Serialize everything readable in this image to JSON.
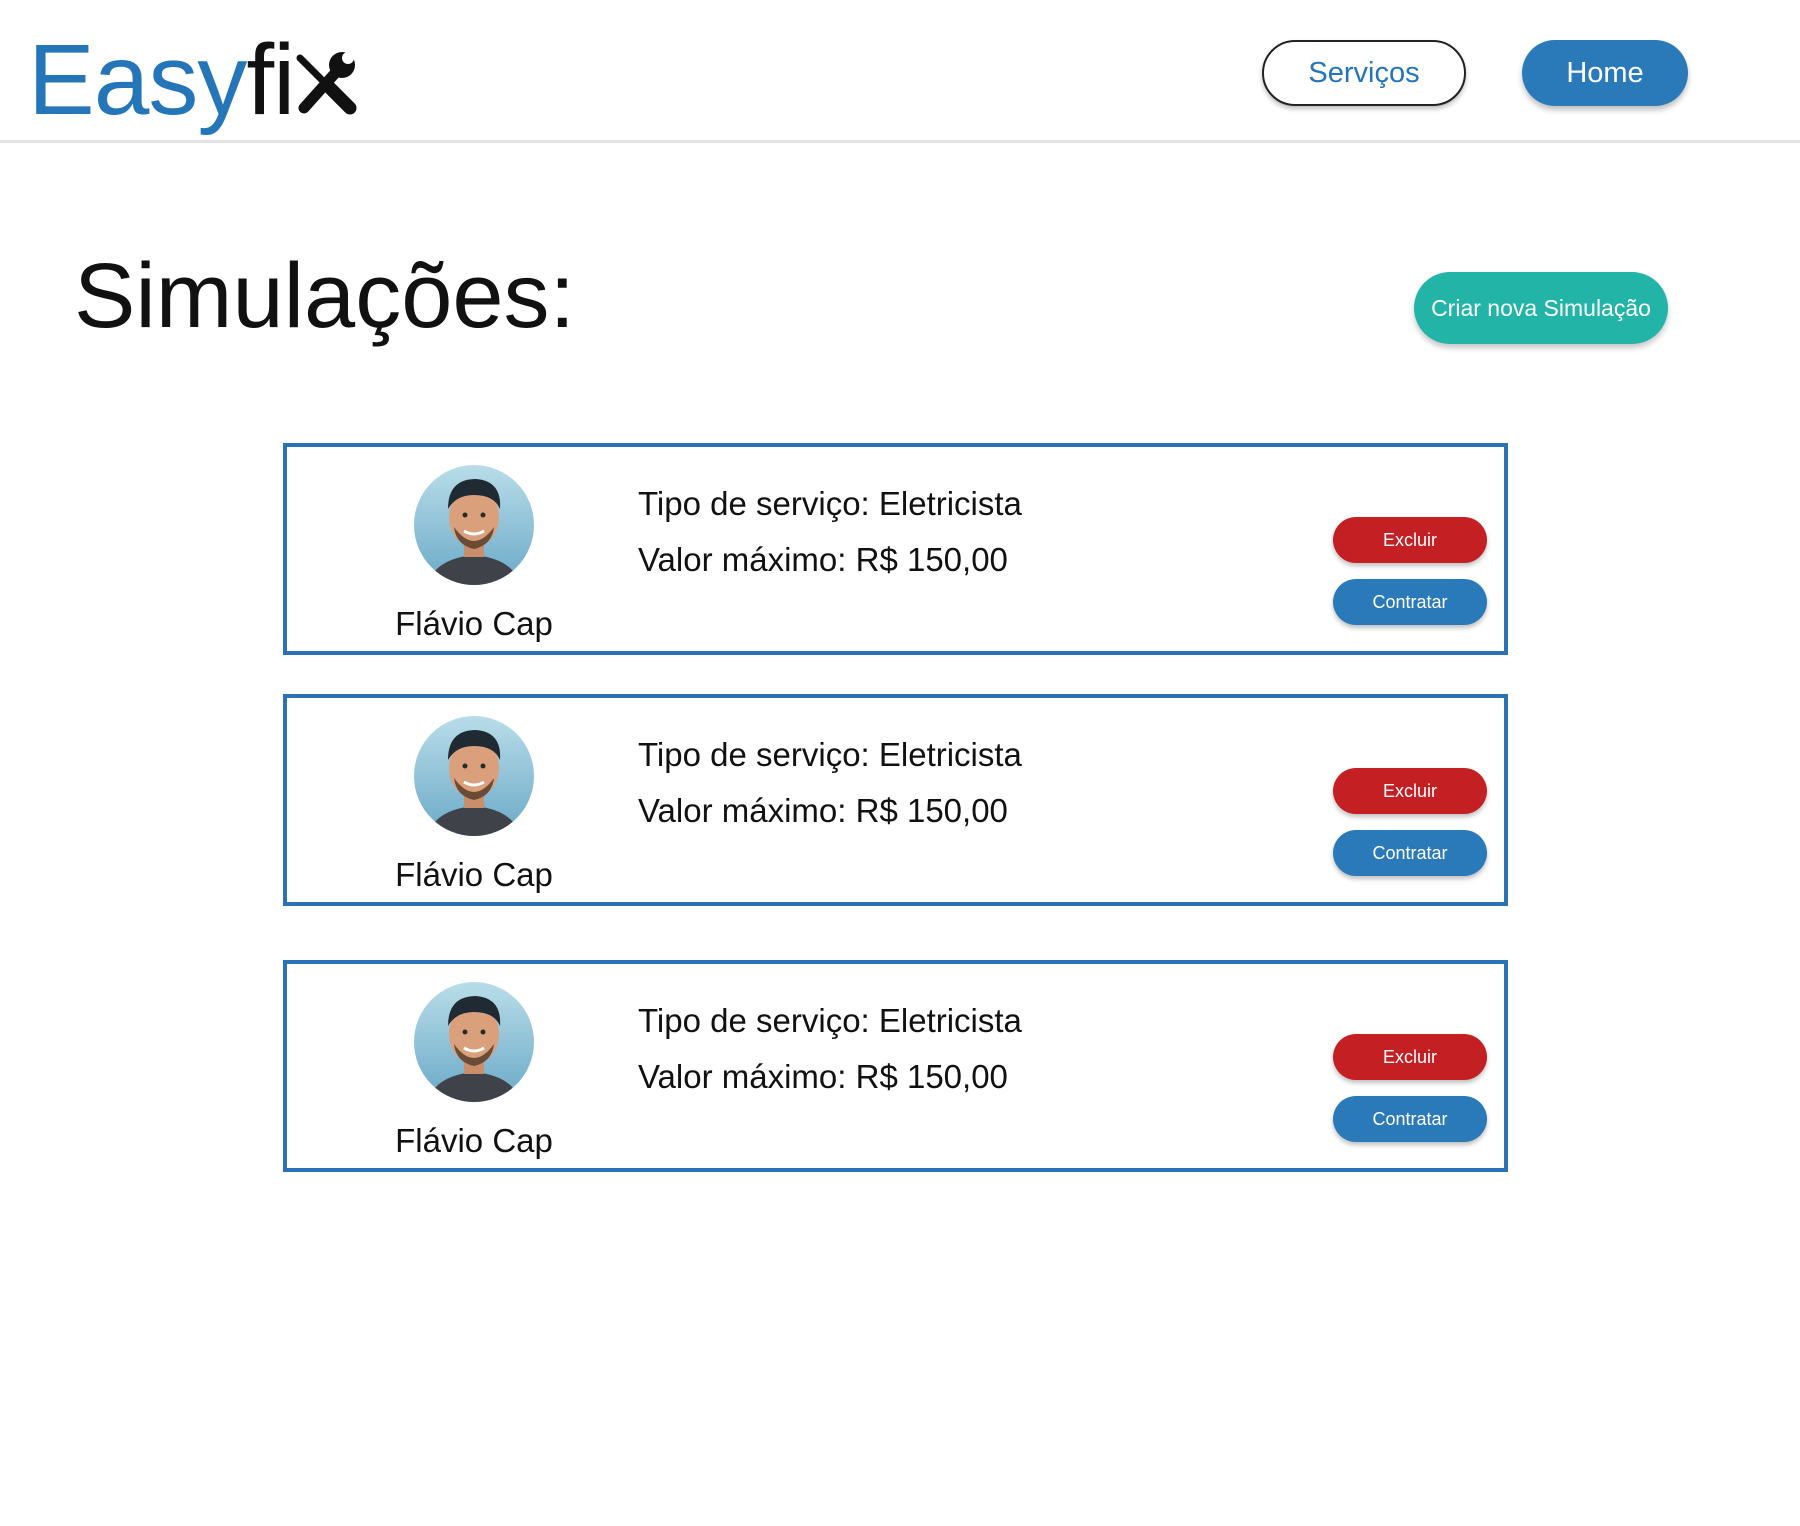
{
  "header": {
    "logo_easy": "Easy",
    "logo_fix": "fi",
    "logo_icon": "wrench-screwdriver-icon",
    "nav": {
      "servicos_label": "Serviços",
      "home_label": "Home"
    }
  },
  "main": {
    "title": "Simulações:",
    "create_button_label": "Criar nova Simulação",
    "simulations": [
      {
        "name": "Flávio Cap",
        "avatar": "avatar-photo",
        "service_type": "Tipo de serviço: Eletricista",
        "max_value": "Valor máximo: R$ 150,00",
        "delete_label": "Excluir",
        "hire_label": "Contratar"
      },
      {
        "name": "Flávio Cap",
        "avatar": "avatar-photo",
        "service_type": "Tipo de serviço: Eletricista",
        "max_value": "Valor máximo: R$ 150,00",
        "delete_label": "Excluir",
        "hire_label": "Contratar"
      },
      {
        "name": "Flávio Cap",
        "avatar": "avatar-photo",
        "service_type": "Tipo de serviço: Eletricista",
        "max_value": "Valor máximo: R$ 150,00",
        "delete_label": "Excluir",
        "hire_label": "Contratar"
      }
    ]
  },
  "colors": {
    "brand_blue": "#2476b8",
    "card_border": "#2a72b4",
    "delete_red": "#c41f23",
    "create_teal": "#21b4a7"
  }
}
